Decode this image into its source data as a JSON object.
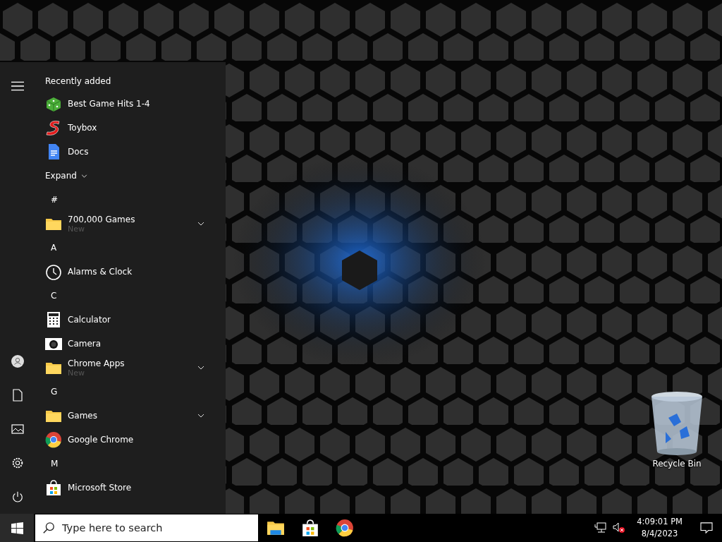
{
  "start_menu": {
    "section_title": "Recently added",
    "recent": [
      {
        "label": "Best Game Hits 1-4",
        "kind": "dice"
      },
      {
        "label": "Toybox",
        "kind": "letter-s"
      },
      {
        "label": "Docs",
        "kind": "docs"
      }
    ],
    "expand": "Expand",
    "groups": [
      {
        "letter": "#",
        "items": [
          {
            "label": "700,000 Games",
            "kind": "folder",
            "sub": "New",
            "expandable": true
          }
        ]
      },
      {
        "letter": "A",
        "items": [
          {
            "label": "Alarms & Clock",
            "kind": "clock",
            "expandable": false
          }
        ]
      },
      {
        "letter": "C",
        "items": [
          {
            "label": "Calculator",
            "kind": "calculator",
            "expandable": false
          },
          {
            "label": "Camera",
            "kind": "camera",
            "expandable": false
          },
          {
            "label": "Chrome Apps",
            "kind": "folder",
            "sub": "New",
            "expandable": true
          }
        ]
      },
      {
        "letter": "G",
        "items": [
          {
            "label": "Games",
            "kind": "folder",
            "expandable": true
          },
          {
            "label": "Google Chrome",
            "kind": "chrome",
            "expandable": false
          }
        ]
      },
      {
        "letter": "M",
        "items": [
          {
            "label": "Microsoft Store",
            "kind": "store",
            "expandable": false
          }
        ]
      }
    ],
    "rail": [
      {
        "kind": "user"
      },
      {
        "kind": "document"
      },
      {
        "kind": "pictures"
      },
      {
        "kind": "settings"
      },
      {
        "kind": "power"
      }
    ]
  },
  "taskbar": {
    "search": {
      "placeholder": "Type here to search"
    },
    "pinned": [
      {
        "kind": "explorer"
      },
      {
        "kind": "store"
      },
      {
        "kind": "chrome"
      }
    ],
    "time": "4:09:01 PM",
    "date": "8/4/2023"
  },
  "desktop_icons": [
    {
      "label": "Recycle Bin"
    }
  ]
}
